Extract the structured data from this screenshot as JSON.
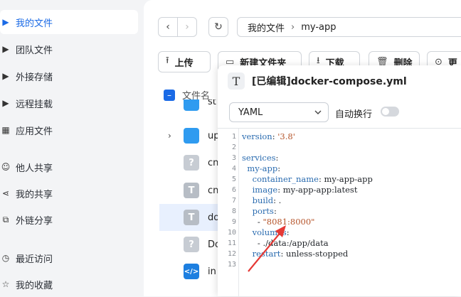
{
  "sidebar": {
    "items": [
      {
        "label": "我的文件",
        "icon": "chevron-right-icon",
        "active": true
      },
      {
        "label": "团队文件",
        "icon": "chevron-right-icon"
      },
      {
        "label": "外接存储",
        "icon": "chevron-right-icon"
      },
      {
        "label": "远程挂载",
        "icon": "chevron-right-icon"
      },
      {
        "label": "应用文件",
        "icon": "apps-grid-icon"
      },
      {
        "label": "他人共享",
        "icon": "users-icon"
      },
      {
        "label": "我的共享",
        "icon": "share-icon"
      },
      {
        "label": "外链分享",
        "icon": "link-icon"
      },
      {
        "label": "最近访问",
        "icon": "clock-icon"
      },
      {
        "label": "我的收藏",
        "icon": "star-icon"
      }
    ]
  },
  "breadcrumb": {
    "root": "我的文件",
    "separator": "›",
    "current": "my-app"
  },
  "toolbar": {
    "upload": "上传",
    "new_folder": "新建文件夹",
    "download": "下载",
    "delete": "删除",
    "more": "更"
  },
  "file_list": {
    "header": "文件名",
    "rows": [
      {
        "name": "st",
        "icon": "folder-icon"
      },
      {
        "name": "up",
        "icon": "folder-icon"
      },
      {
        "name": "cn",
        "icon": "unknown-file-icon"
      },
      {
        "name": "cn",
        "icon": "text-file-icon"
      },
      {
        "name": "do",
        "icon": "text-file-icon"
      },
      {
        "name": "Do",
        "icon": "unknown-file-icon"
      },
      {
        "name": "in",
        "icon": "code-file-icon"
      }
    ]
  },
  "editor": {
    "title": "[已编辑]docker-compose.yml",
    "title_icon": "T",
    "language": "YAML",
    "wrap_label": "自动换行",
    "wrap_enabled": false,
    "line_numbers": [
      "1",
      "2",
      "3",
      "4",
      "5",
      "6",
      "7",
      "8",
      "9",
      "10",
      "11",
      "12",
      "13"
    ],
    "lines": [
      "version: '3.8'",
      "",
      "services:",
      "  my-app:",
      "    container_name: my-app-app",
      "    image: my-app-app:latest",
      "    build: .",
      "    ports:",
      "      - \"8081:8000\"",
      "    volumes:",
      "      - ./data:/app/data",
      "    restart: unless-stopped",
      ""
    ]
  },
  "colors": {
    "accent": "#1a6ae6",
    "arrow": "#e53935"
  }
}
